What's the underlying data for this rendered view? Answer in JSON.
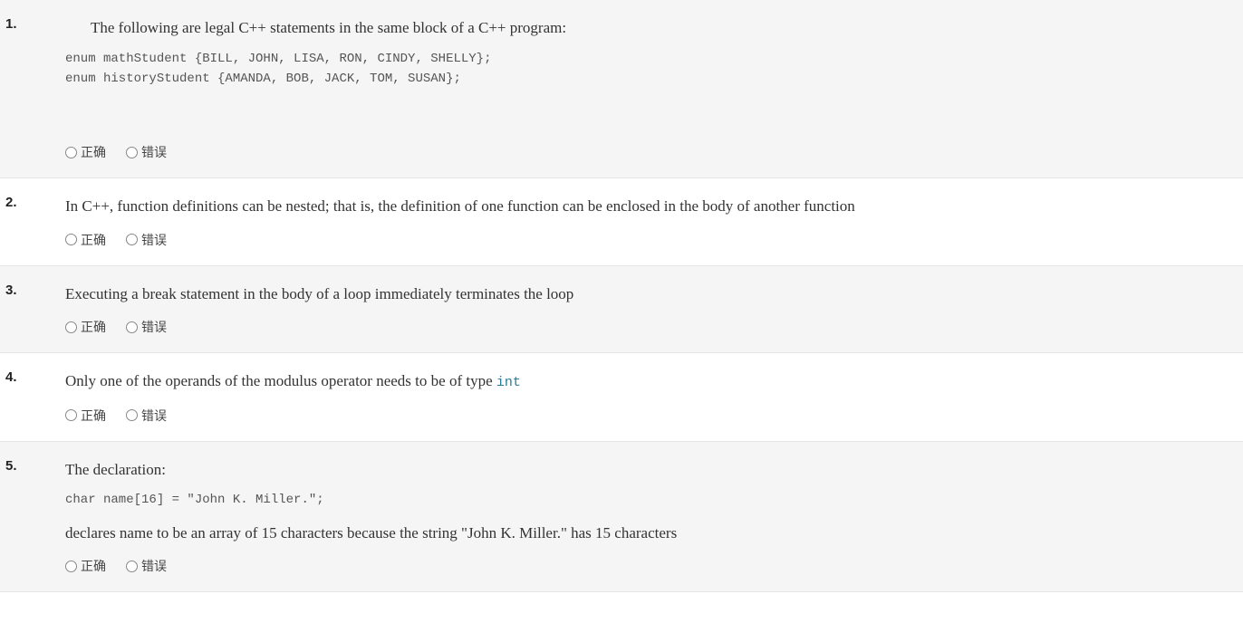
{
  "questions": [
    {
      "number": "1.",
      "text_before": "The following are legal C++ statements in the same block of a C++ program:",
      "code": "enum mathStudent {BILL, JOHN, LISA, RON, CINDY, SHELLY};\nenum historyStudent {AMANDA, BOB, JACK, TOM, SUSAN};",
      "text_after": "",
      "indent": true,
      "spacer": true,
      "shaded": true,
      "options": {
        "true": "正确",
        "false": "错误"
      }
    },
    {
      "number": "2.",
      "text_before": "In C++, function definitions can be nested; that is, the definition of one function can be enclosed in the body of another function",
      "code": "",
      "text_after": "",
      "indent": false,
      "spacer": false,
      "shaded": false,
      "options": {
        "true": "正确",
        "false": "错误"
      }
    },
    {
      "number": "3.",
      "text_before": "Executing a break statement in the body of a loop immediately terminates the loop",
      "code": "",
      "text_after": "",
      "indent": false,
      "spacer": false,
      "shaded": true,
      "options": {
        "true": "正确",
        "false": "错误"
      }
    },
    {
      "number": "4.",
      "text_before": "Only one of the operands of the modulus operator needs to be of type ",
      "inline_code": "int",
      "code": "",
      "text_after": "",
      "indent": false,
      "spacer": false,
      "shaded": false,
      "options": {
        "true": "正确",
        "false": "错误"
      }
    },
    {
      "number": "5.",
      "text_before": "The declaration:",
      "code": "char name[16] = \"John K. Miller.\";",
      "text_after": "declares name to be an array of 15 characters because the string \"John K. Miller.\" has 15 characters",
      "indent": false,
      "spacer": false,
      "shaded": true,
      "options": {
        "true": "正确",
        "false": "错误"
      }
    }
  ]
}
